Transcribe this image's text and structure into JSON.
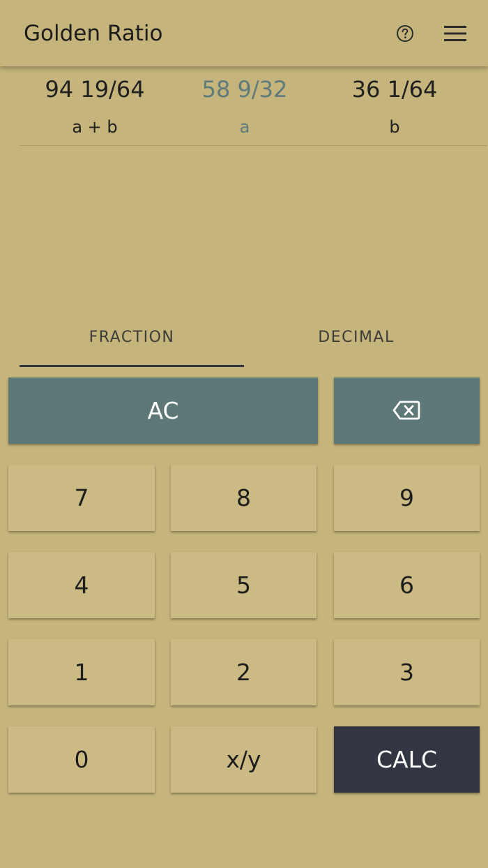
{
  "appbar": {
    "title": "Golden Ratio",
    "icons": {
      "help": "help-circle-icon",
      "menu": "hamburger-menu-icon"
    }
  },
  "results": [
    {
      "value": "94 19/64",
      "label": "a + b",
      "active": false
    },
    {
      "value": "58 9/32",
      "label": "a",
      "active": true
    },
    {
      "value": "36 1/64",
      "label": "b",
      "active": false
    }
  ],
  "tabs": {
    "fraction": "FRACTION",
    "decimal": "DECIMAL",
    "selected": "fraction"
  },
  "keys": {
    "ac": "AC",
    "backspace_icon": "backspace-icon",
    "k7": "7",
    "k8": "8",
    "k9": "9",
    "k4": "4",
    "k5": "5",
    "k6": "6",
    "k1": "1",
    "k2": "2",
    "k3": "3",
    "k0": "0",
    "fraction_sep": "x/y",
    "calc": "CALC"
  },
  "colors": {
    "background": "#c5b47b",
    "key": "#cbba84",
    "key_action": "#5e7878",
    "key_calc": "#323643",
    "accent_active": "#5e7a7c",
    "tab_indicator": "#33363f"
  }
}
